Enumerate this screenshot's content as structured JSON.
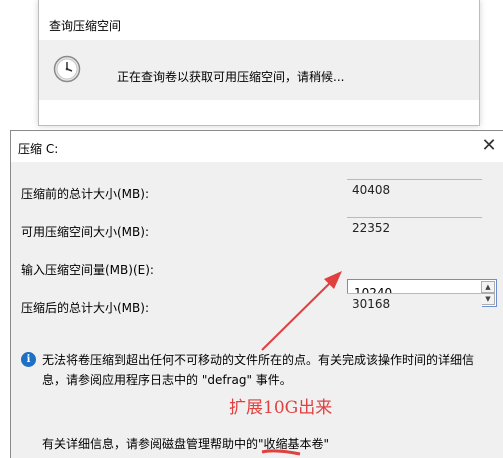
{
  "query_dialog": {
    "title": "查询压缩空间",
    "message": "正在查询卷以获取可用压缩空间，请稍候...",
    "icon": "clock-icon"
  },
  "compress_dialog": {
    "title": "压缩 C:",
    "close_icon": "close-icon",
    "fields": {
      "total_before": {
        "label": "压缩前的总计大小(MB):",
        "value": "40408"
      },
      "available": {
        "label": "可用压缩空间大小(MB):",
        "value": "22352"
      },
      "shrink_amount": {
        "label": "输入压缩空间量(MB)(E):",
        "value": "10240"
      },
      "total_after": {
        "label": "压缩后的总计大小(MB):",
        "value": "30168"
      }
    },
    "info_icon": "info-icon",
    "info_text": "无法将卷压缩到超出任何不可移动的文件所在的点。有关完成该操作时间的详细信息，请参阅应用程序日志中的 \"defrag\" 事件。",
    "annotation": "扩展10G出来",
    "help_text": "有关详细信息，请参阅磁盘管理帮助中的\"收缩基本卷\"",
    "annotation_color": "#e04040"
  }
}
